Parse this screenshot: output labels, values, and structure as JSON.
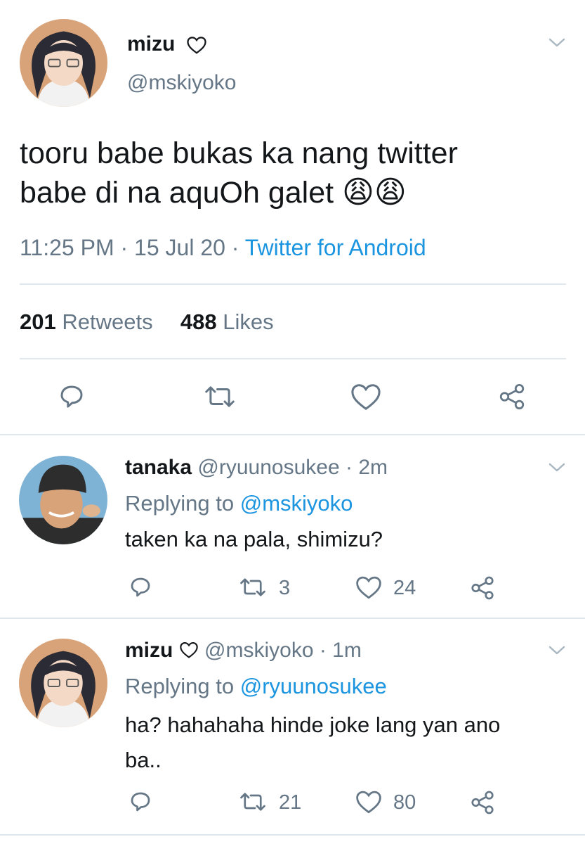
{
  "main_tweet": {
    "display_name": "mizu",
    "handle": "@mskiyoko",
    "text_line1": "tooru babe bukas ka nang twitter",
    "text_line2": "babe di na aquOh galet",
    "emojis": "😩😩",
    "time": "11:25 PM",
    "sep1": "·",
    "date": "15 Jul 20",
    "sep2": "·",
    "source": "Twitter for Android",
    "retweets_count": "201",
    "retweets_label": "Retweets",
    "likes_count": "488",
    "likes_label": "Likes"
  },
  "replies": [
    {
      "display_name": "tanaka",
      "handle": "@ryuunosukee",
      "time": "· 2m",
      "replying_prefix": "Replying to",
      "replying_to": "@mskiyoko",
      "text": "taken ka na pala, shimizu?",
      "retweets": "3",
      "likes": "24"
    },
    {
      "display_name": "mizu",
      "handle": "@mskiyoko",
      "time": "· 1m",
      "replying_prefix": "Replying to",
      "replying_to": "@ryuunosukee",
      "text_line1": "ha? hahahaha hinde joke lang yan ano",
      "text_line2": "ba..",
      "retweets": "21",
      "likes": "80"
    }
  ],
  "colors": {
    "text": "#14171a",
    "muted": "#657786",
    "link": "#1b95e0",
    "divider": "#e1e8ed"
  }
}
